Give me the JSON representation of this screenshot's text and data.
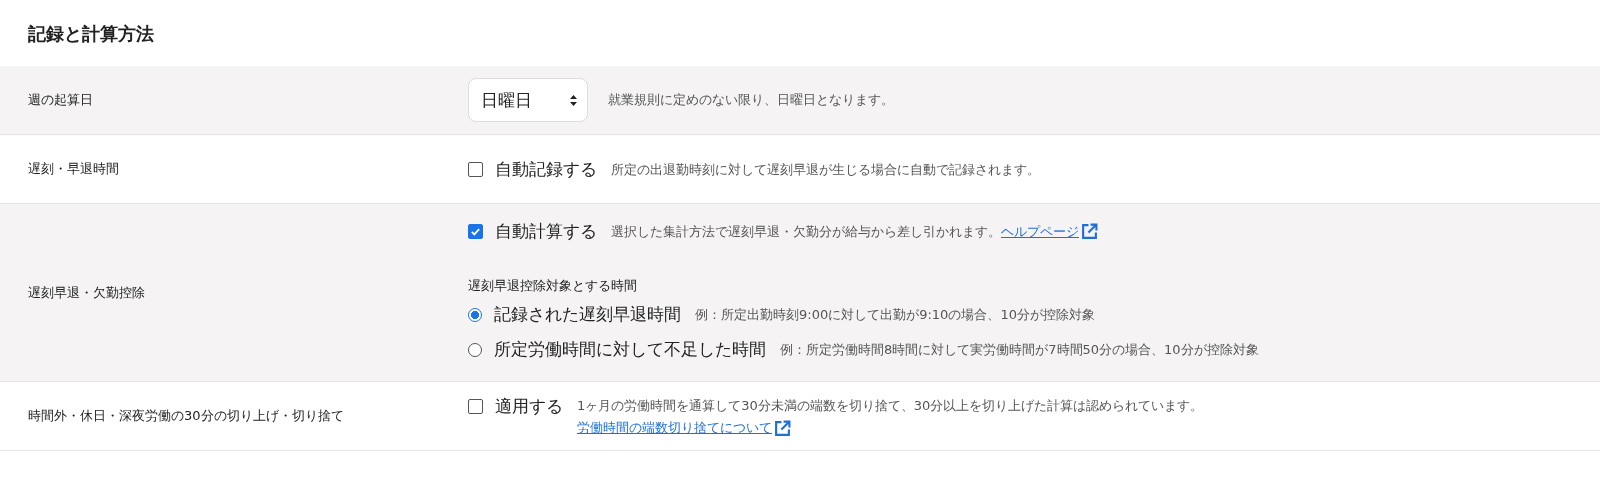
{
  "section_title": "記録と計算方法",
  "rows": [
    {
      "label": "週の起算日",
      "kind": "select",
      "select": {
        "value": "日曜日"
      },
      "note": "就業規則に定めのない限り、日曜日となります。"
    },
    {
      "label": "遅刻・早退時間",
      "kind": "checkbox",
      "checkbox": {
        "label": "自動記録する",
        "checked": false
      },
      "note": "所定の出退勤時刻に対して遅刻早退が生じる場合に自動で記録されます。"
    },
    {
      "label": "遅刻早退・欠勤控除",
      "kind": "checkbox",
      "checkbox": {
        "label": "自動計算する",
        "checked": true
      },
      "note": "選択した集計方法で遅刻早退・欠勤分が給与から差し引かれます。",
      "link": {
        "text": "ヘルプページ"
      },
      "radio_group": {
        "heading": "遅刻早退控除対象とする時間",
        "options": [
          {
            "label": "記録された遅刻早退時間",
            "selected": true,
            "example": "例：所定出勤時刻9:00に対して出勤が9:10の場合、10分が控除対象"
          },
          {
            "label": "所定労働時間に対して不足した時間",
            "selected": false,
            "example": "例：所定労働時間8時間に対して実労働時間が7時間50分の場合、10分が控除対象"
          }
        ]
      }
    },
    {
      "label": "時間外・休日・深夜労働の30分の切り上げ・切り捨て",
      "kind": "checkbox",
      "checkbox": {
        "label": "適用する",
        "checked": false
      },
      "note": "1ヶ月の労働時間を通算して30分未満の端数を切り捨て、30分以上を切り上げた計算は認められています。",
      "link_below": {
        "text": "労働時間の端数切り捨てについて"
      }
    }
  ]
}
